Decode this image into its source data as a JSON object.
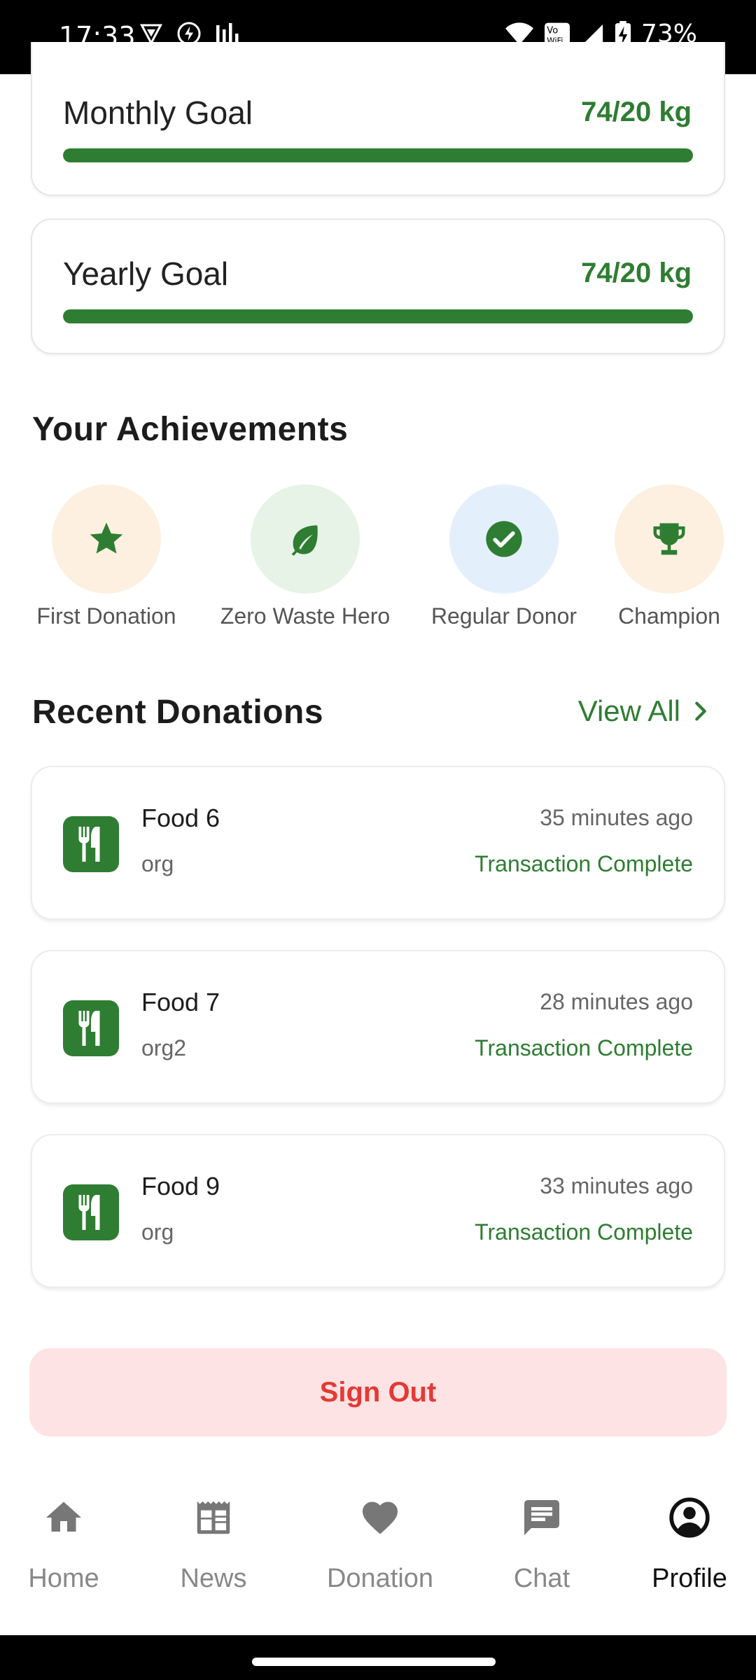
{
  "status_bar": {
    "time": "17:33",
    "battery": "73%"
  },
  "goals": {
    "monthly": {
      "label": "Monthly Goal",
      "value": "74/20 kg",
      "progress": 1.0
    },
    "yearly": {
      "label": "Yearly Goal",
      "value": "74/20 kg",
      "progress": 1.0
    }
  },
  "achievements": {
    "title": "Your Achievements",
    "items": [
      {
        "label": "First Donation",
        "icon": "star-icon",
        "bg": "#fdf0e0"
      },
      {
        "label": "Zero Waste Hero",
        "icon": "leaf-icon",
        "bg": "#e6f3e6"
      },
      {
        "label": "Regular Donor",
        "icon": "check-circle-icon",
        "bg": "#e3f0fc"
      },
      {
        "label": "Champion",
        "icon": "trophy-icon",
        "bg": "#fdf0e0"
      }
    ]
  },
  "recent": {
    "title": "Recent Donations",
    "view_all": "View All",
    "items": [
      {
        "name": "Food 6",
        "org": "org",
        "time": "35 minutes ago",
        "status": "Transaction Complete"
      },
      {
        "name": "Food 7",
        "org": "org2",
        "time": "28 minutes ago",
        "status": "Transaction Complete"
      },
      {
        "name": "Food 9",
        "org": "org",
        "time": "33 minutes ago",
        "status": "Transaction Complete"
      }
    ]
  },
  "sign_out": "Sign Out",
  "nav": {
    "items": [
      {
        "label": "Home",
        "icon": "home-icon"
      },
      {
        "label": "News",
        "icon": "news-icon"
      },
      {
        "label": "Donation",
        "icon": "heart-icon"
      },
      {
        "label": "Chat",
        "icon": "chat-icon"
      },
      {
        "label": "Profile",
        "icon": "account-circle-icon",
        "active": true
      }
    ]
  },
  "colors": {
    "accent": "#2e7d32",
    "danger": "#e53935",
    "danger_bg": "#fde3e3"
  }
}
